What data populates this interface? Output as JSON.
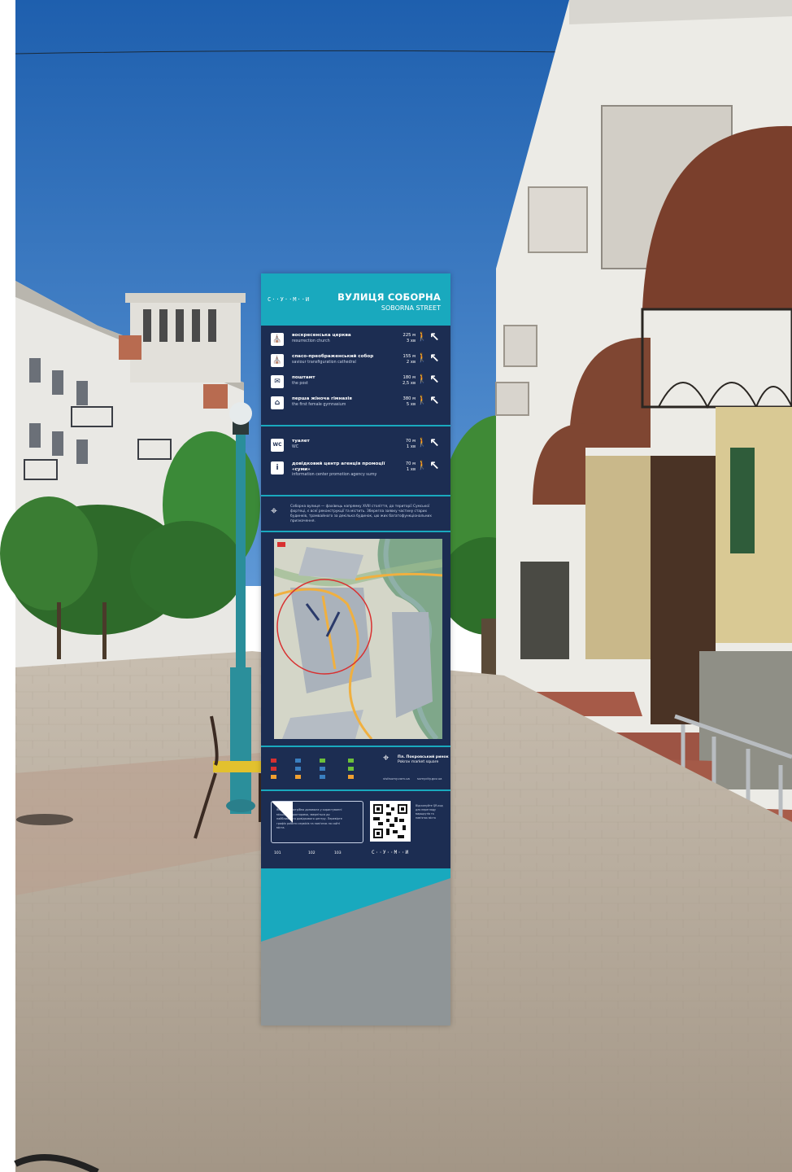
{
  "stele": {
    "logo": "С··У··М··И",
    "title_uk": "ВУЛИЦЯ СОБОРНА",
    "title_en": "SOBORNA STREET",
    "destinations": [
      {
        "icon": "church-icon",
        "glyph": "⛪",
        "name_uk": "воскресенська церква",
        "name_en": "resurrection church",
        "dist_m": "225 м",
        "time": "3 хв"
      },
      {
        "icon": "cathedral-icon",
        "glyph": "⛪",
        "name_uk": "спасо-преображенський собор",
        "name_en": "saviour transfiguration cathedral",
        "dist_m": "155 м",
        "time": "2 хв"
      },
      {
        "icon": "post-icon",
        "glyph": "✉",
        "name_uk": "поштамт",
        "name_en": "the post",
        "dist_m": "180 м",
        "time": "2,5 хв"
      },
      {
        "icon": "gymnasium-icon",
        "glyph": "⌂",
        "name_uk": "перша жіноча гімназія",
        "name_en": "the first female gymnasium",
        "dist_m": "380 м",
        "time": "5 хв"
      }
    ],
    "services": [
      {
        "icon": "wc-icon",
        "glyph": "WC",
        "name_uk": "туалет",
        "name_en": "WC",
        "dist_m": "70 м",
        "time": "1 хв"
      },
      {
        "icon": "info-icon",
        "glyph": "i",
        "name_uk": "довідковий центр агенція промоції «суми»",
        "name_en": "information center promotion agency sumy",
        "dist_m": "70 м",
        "time": "1 хв"
      }
    ],
    "about": "Соборна вулиця — фахівець напрямку XVIII століття, до території Сумської фортеці, є всеї реконструкції та містить. Зберегла заявку частину старих будинків, трамвайного за декілька будинок, цю жих багатофункціональних призначення.",
    "square_uk": "Пл. Покровський ринок",
    "square_en": "Pokrov market square",
    "web_left": "visitsumy.com.ua",
    "web_right": "sumycity.gov.ua",
    "info_text": "Якщо вам потрібна допомога у користуванні міськими просторами, зверніться до найближчого довідкового центру. Перевірте графік роботи сервісів та пам'яток на сайті міста.",
    "qr_text": "Відскануйте QR-код для перегляду маршрутів та пам'яток міста",
    "foot_numbers": [
      "101",
      "102",
      "103"
    ],
    "colors": {
      "panel": "#1c2d52",
      "accent": "#19a9be"
    }
  }
}
